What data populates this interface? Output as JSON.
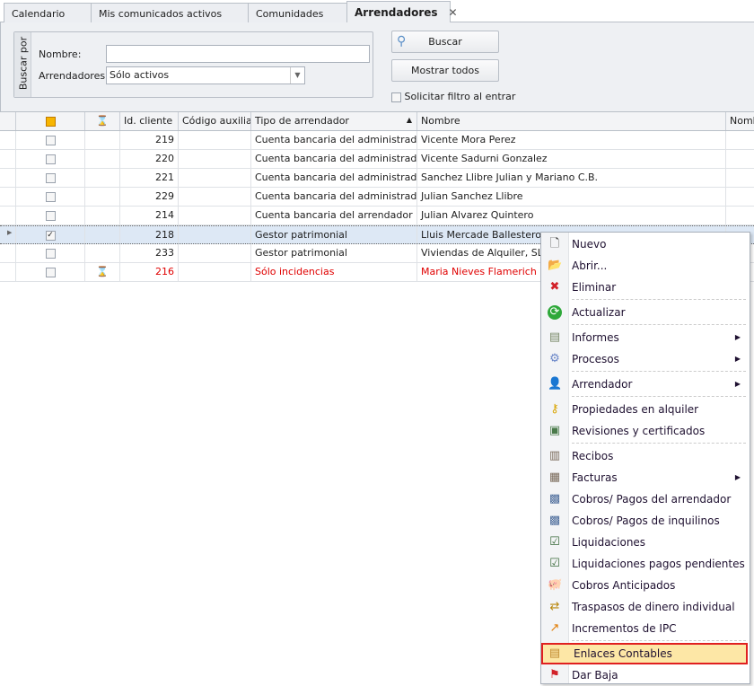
{
  "tabs": [
    {
      "label": "Calendario"
    },
    {
      "label": "Mis comunicados activos"
    },
    {
      "label": "Comunidades"
    },
    {
      "label": "Arrendadores",
      "close": "✕"
    }
  ],
  "search": {
    "group_title": "Buscar por",
    "nombre_label": "Nombre:",
    "nombre_value": "",
    "arrendadores_label": "Arrendadores:",
    "arrendadores_value": "Sólo activos",
    "buscar": "Buscar",
    "mostrar_todos": "Mostrar todos",
    "solicitar": "Solicitar filtro al entrar"
  },
  "grid": {
    "headers": [
      "Id. cliente",
      "Código auxiliar",
      "Tipo de arrendador",
      "Nombre",
      "Nombr"
    ],
    "rows": [
      {
        "id": "219",
        "tipo": "Cuenta bancaria del administrador",
        "nombre": "Vicente Mora Perez",
        "checked": false
      },
      {
        "id": "220",
        "tipo": "Cuenta bancaria del administrador",
        "nombre": "Vicente Sadurni Gonzalez",
        "checked": false
      },
      {
        "id": "221",
        "tipo": "Cuenta bancaria del administrador",
        "nombre": "Sanchez Llibre Julian y Mariano C.B.",
        "checked": false
      },
      {
        "id": "229",
        "tipo": "Cuenta bancaria del administrador",
        "nombre": "Julian Sanchez Llibre",
        "checked": false
      },
      {
        "id": "214",
        "tipo": "Cuenta bancaria del arrendador",
        "nombre": "Julian Alvarez Quintero",
        "checked": false
      },
      {
        "id": "218",
        "tipo": "Gestor patrimonial",
        "nombre": "Lluis Mercade Ballesteros",
        "checked": true,
        "selected": true
      },
      {
        "id": "233",
        "tipo": "Gestor patrimonial",
        "nombre": "Viviendas de Alquiler, SL",
        "checked": false
      },
      {
        "id": "216",
        "tipo": "Sólo incidencias",
        "nombre": "Maria Nieves Flamerich Mira",
        "checked": false,
        "red": true,
        "hourglass": true
      }
    ]
  },
  "menu": {
    "items": [
      {
        "label": "Nuevo",
        "icon": "new-document-icon"
      },
      {
        "label": "Abrir...",
        "icon": "folder-open-icon"
      },
      {
        "label": "Eliminar",
        "icon": "delete-x-icon"
      },
      {
        "label": "Actualizar",
        "icon": "refresh-icon"
      },
      {
        "label": "Informes",
        "icon": "report-icon",
        "sub": true
      },
      {
        "label": "Procesos",
        "icon": "gear-icon",
        "sub": true
      },
      {
        "label": "Arrendador",
        "icon": "user-icon",
        "sub": true
      },
      {
        "label": "Propiedades en alquiler",
        "icon": "key-icon"
      },
      {
        "label": "Revisiones y certificados",
        "icon": "certificate-icon"
      },
      {
        "label": "Recibos",
        "icon": "receipt-icon"
      },
      {
        "label": "Facturas",
        "icon": "invoice-icon",
        "sub": true
      },
      {
        "label": "Cobros/ Pagos del arrendador",
        "icon": "calculator-icon"
      },
      {
        "label": "Cobros/ Pagos de inquilinos",
        "icon": "calculator-icon"
      },
      {
        "label": "Liquidaciones",
        "icon": "settlement-icon"
      },
      {
        "label": "Liquidaciones pagos pendientes",
        "icon": "settlement-icon"
      },
      {
        "label": "Cobros Anticipados",
        "icon": "piggy-bank-icon"
      },
      {
        "label": "Traspasos de dinero individual",
        "icon": "money-transfer-icon"
      },
      {
        "label": "Incrementos de IPC",
        "icon": "chart-up-icon"
      },
      {
        "label": "Enlaces Contables",
        "icon": "accounting-link-icon",
        "highlighted": true
      },
      {
        "label": "Dar Baja",
        "icon": "flag-icon"
      }
    ]
  }
}
